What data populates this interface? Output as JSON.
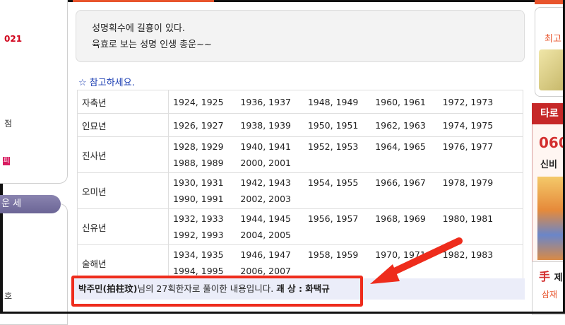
{
  "left_sidebar": {
    "year_fragment": "021",
    "text_fragment_1": "점",
    "badge": "피",
    "tab_label": "운 세",
    "text_fragment_2": "호"
  },
  "intro": {
    "line1": "성명획수에 길흉이 있다.",
    "line2": "육효로 보는 성명 인생 총운~~"
  },
  "notice": {
    "star": "☆",
    "text": "참고하세요."
  },
  "zodiac_table": [
    {
      "label": "자축년",
      "years": "1924, 1925      1936, 1937      1948, 1949      1960, 1961      1972, 1973"
    },
    {
      "label": "인묘년",
      "years": "1926, 1927      1938, 1939      1950, 1951      1962, 1963      1974, 1975"
    },
    {
      "label": "진사년",
      "years": "1928, 1929      1940, 1941      1952, 1953      1964, 1965      1976, 1977      1988, 1989      2000, 2001"
    },
    {
      "label": "오미년",
      "years": "1930, 1931      1942, 1943      1954, 1955      1966, 1967      1978, 1979      1990, 1991      2002, 2003"
    },
    {
      "label": "신유년",
      "years": "1932, 1933      1944, 1945      1956, 1957      1968, 1969      1980, 1981      1992, 1993      2004, 2005"
    },
    {
      "label": "술해년",
      "years": "1934, 1935      1946, 1947      1958, 1959      1970, 1971      1982, 1983      1994, 1995      2006, 2007"
    }
  ],
  "result": {
    "name": "박주민(拍柱玟)",
    "text": "님의 27획한자로 풀이한 내용입니다.",
    "gwae_label": "괘 상 : 화택규"
  },
  "right_sidebar": {
    "text_1": "최고",
    "header_2": "타로",
    "phone_fragment": "060",
    "text_3": "신비",
    "text_4_char": "手",
    "text_4_rest": "제",
    "text_5": "삼재"
  },
  "colors": {
    "accent_red": "#ee2c1c",
    "link_blue": "#1a3db3",
    "result_bg": "#ebedf9"
  }
}
